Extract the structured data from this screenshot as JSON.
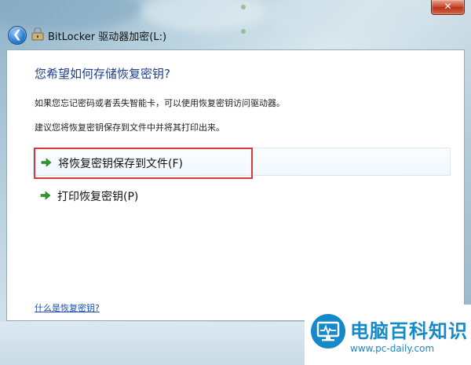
{
  "window": {
    "title": "BitLocker 驱动器加密(L:)",
    "close_glyph": "✕",
    "back_glyph": "❮"
  },
  "background_text": [
    "",
    ""
  ],
  "main": {
    "heading": "您希望如何存储恢复密钥?",
    "para1": "如果您忘记密码或者丢失智能卡，可以使用恢复密钥访问驱动器。",
    "para2": "建议您将恢复密钥保存到文件中并将其打印出来。",
    "options": [
      {
        "label": "将恢复密钥保存到文件(F)",
        "icon": "green-arrow-icon"
      },
      {
        "label": "打印恢复密钥(P)",
        "icon": "green-arrow-icon"
      }
    ],
    "help_link": "什么是恢复密钥?"
  },
  "watermark": {
    "brand": "电脑百科知识",
    "url": "www.pc-daily.com"
  },
  "colors": {
    "heading": "#1e3e8e",
    "link": "#1a4fb0",
    "highlight": "#d43a3a",
    "brand": "#1689c9",
    "arrow": "#2c9a2c"
  }
}
